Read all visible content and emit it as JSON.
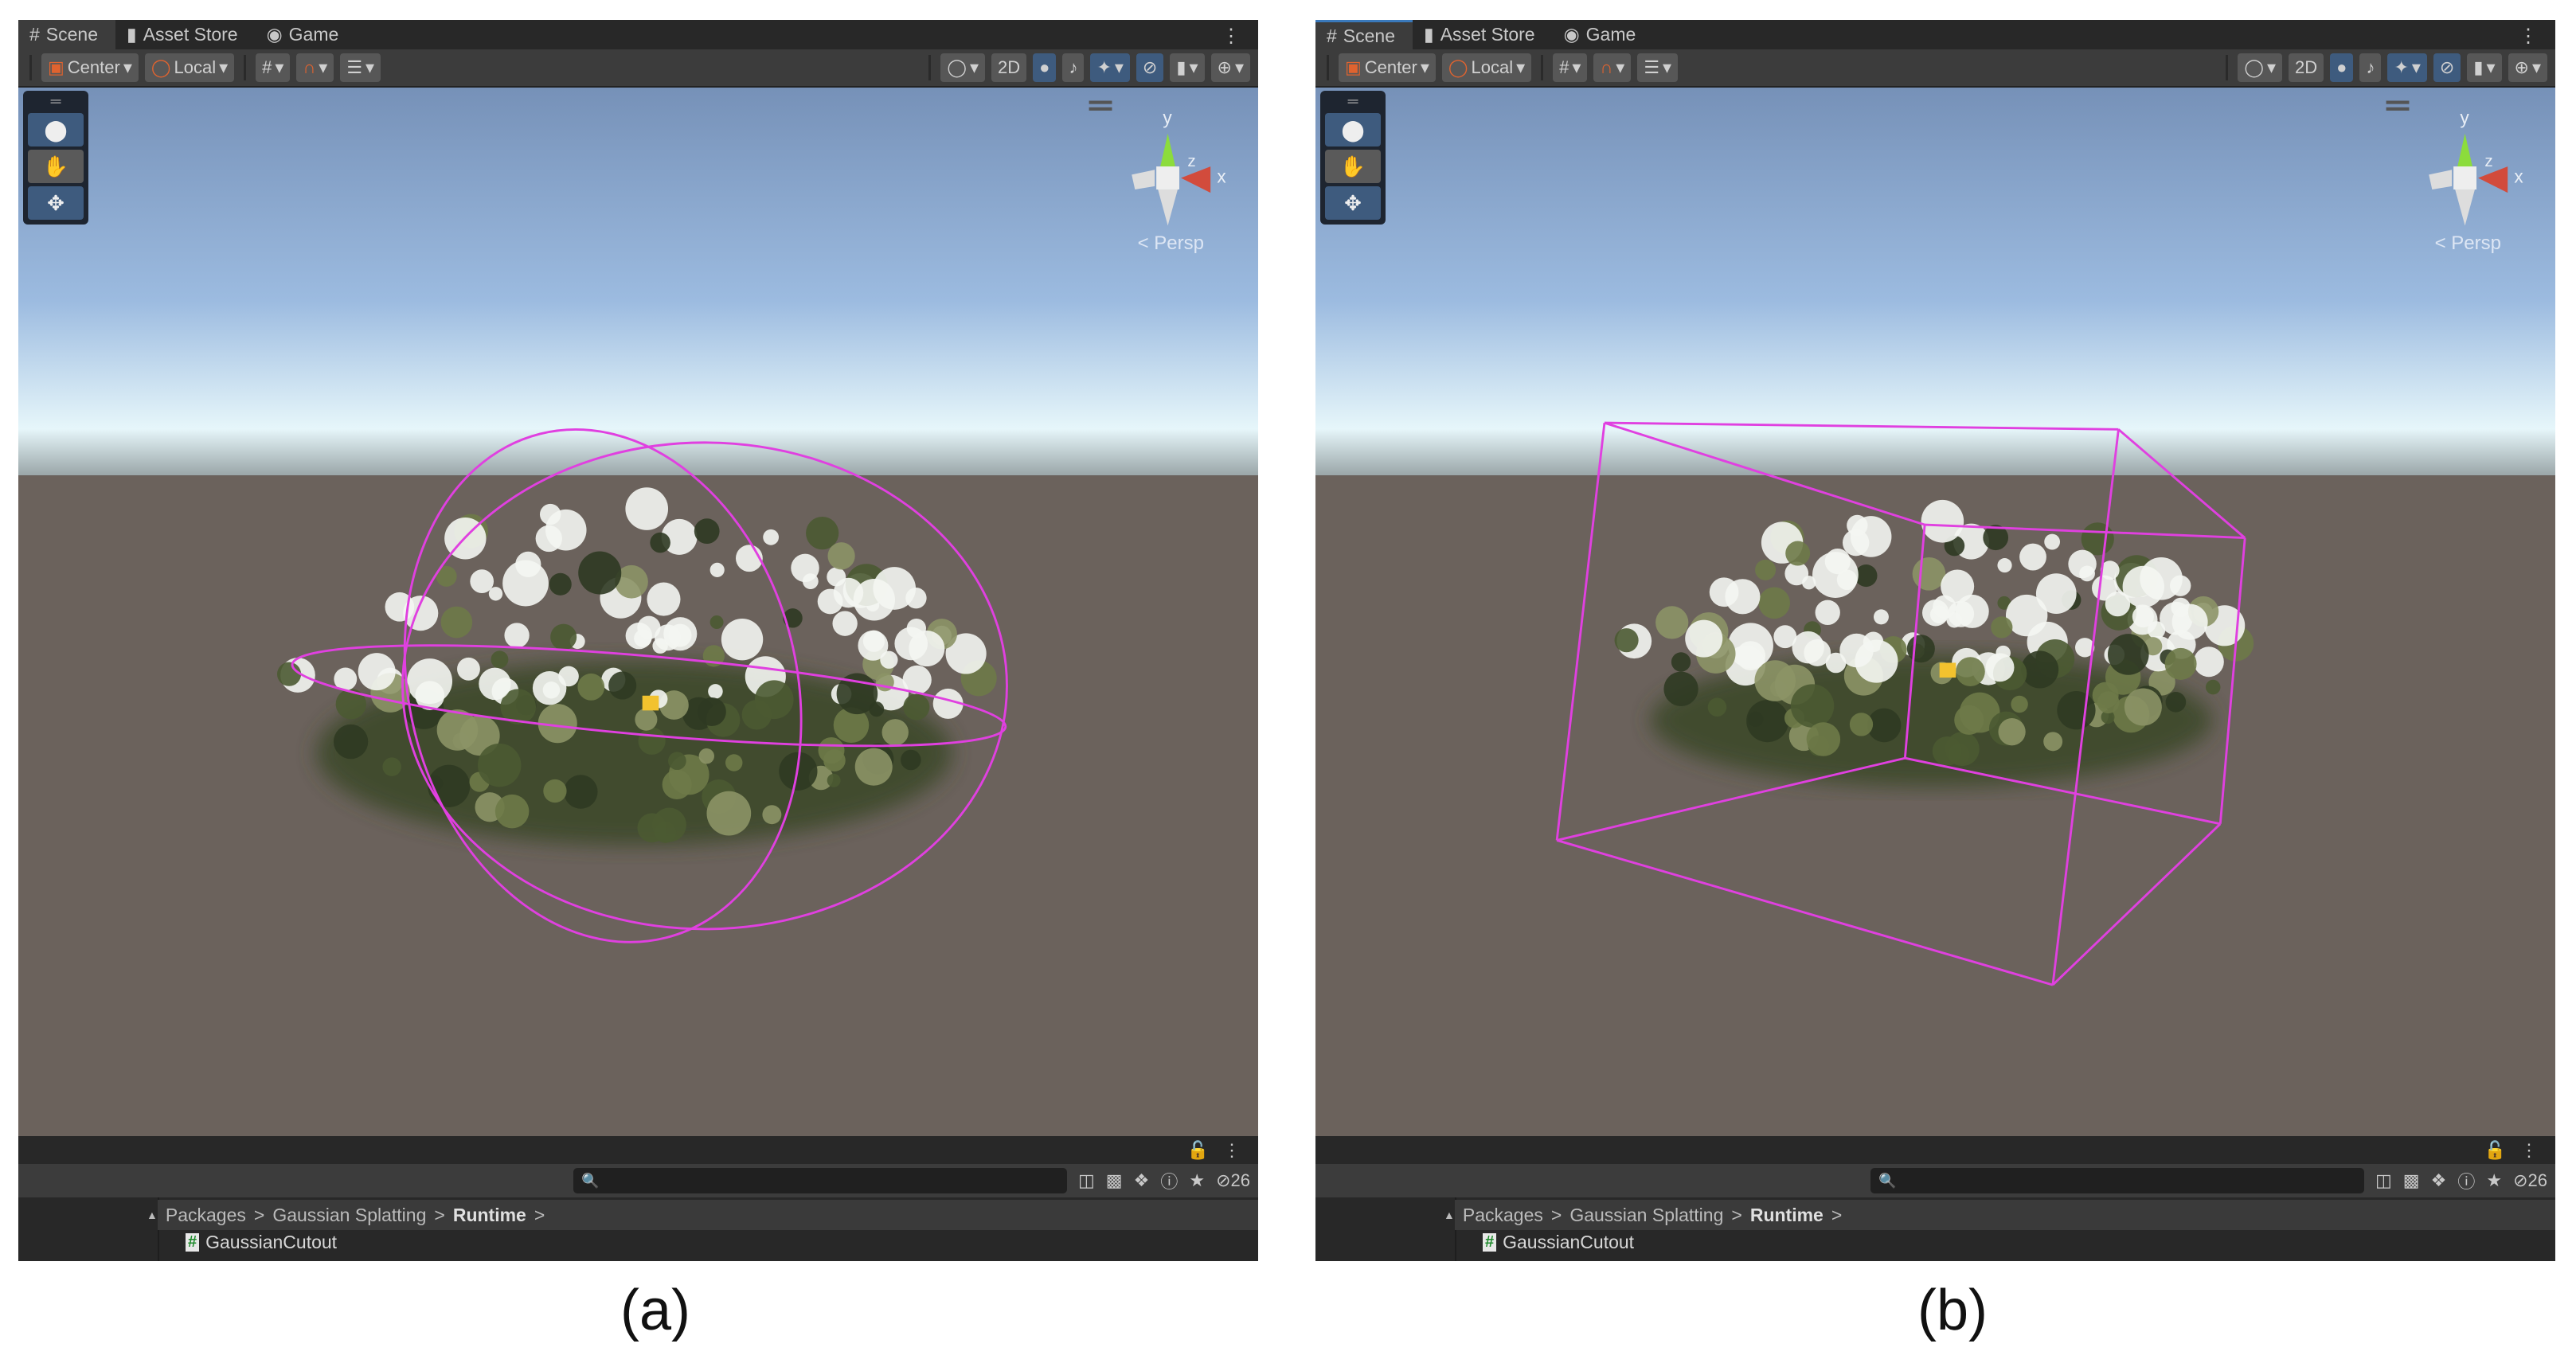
{
  "tabs": [
    {
      "label": "Scene",
      "icon": "grid-icon"
    },
    {
      "label": "Asset Store",
      "icon": "bag-icon"
    },
    {
      "label": "Game",
      "icon": "gamepad-icon"
    }
  ],
  "toolbar": {
    "pivot": "Center",
    "space": "Local",
    "mode_2d": "2D"
  },
  "viewport": {
    "camera_label": "< Persp",
    "axes": {
      "x": "x",
      "y": "y",
      "z": "z"
    }
  },
  "console": {
    "hidden_count": "26",
    "search_placeholder": ""
  },
  "breadcrumb": {
    "items": [
      "Packages",
      "Gaussian Splatting",
      "Runtime"
    ],
    "sep": ">"
  },
  "file": {
    "name": "GaussianCutout",
    "icon": "#"
  },
  "panels": [
    {
      "caption": "(a)",
      "cutout_shape": "ellipsoid"
    },
    {
      "caption": "(b)",
      "cutout_shape": "box"
    }
  ],
  "colors": {
    "gizmo": "#e040e0",
    "active_button": "#3e5b7e",
    "ground": "#6b625c"
  }
}
